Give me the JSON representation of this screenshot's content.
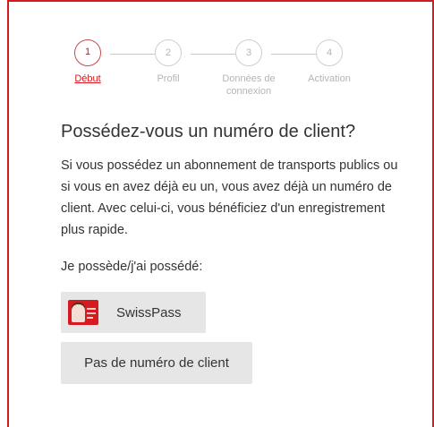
{
  "stepper": {
    "steps": [
      {
        "number": "1",
        "label": "Début"
      },
      {
        "number": "2",
        "label": "Profil"
      },
      {
        "number": "3",
        "label": "Données de connexion"
      },
      {
        "number": "4",
        "label": "Activation"
      }
    ],
    "active_step": 1
  },
  "title": "Possédez-vous un numéro de client?",
  "intro": "Si vous possédez un abonnement de transports publics ou si vous en avez déjà eu un, vous avez déjà un numéro de client. Avec celui-ci, vous bénéficiez d'un enregistrement plus rapide.",
  "own_label": "Je possède/j'ai possédé:",
  "buttons": {
    "swisspass": "SwissPass",
    "no_number": "Pas de numéro de client"
  },
  "colors": {
    "accent": "#d71920",
    "button_bg": "#e6e6e6",
    "inactive": "#b5b5b5"
  },
  "icons": {
    "swisspass_card": "swisspass-card-icon"
  }
}
